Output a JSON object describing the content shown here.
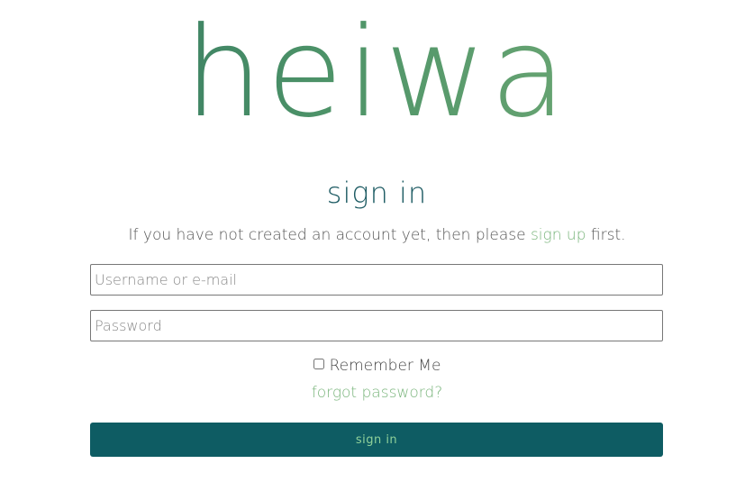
{
  "brand": {
    "logo_text": "heiwa"
  },
  "signin": {
    "title": "sign in",
    "intro_before": "If you have not created an account yet, then please ",
    "signup_link": "sign up",
    "intro_after": " first.",
    "username_placeholder": "Username or e-mail",
    "password_placeholder": "Password",
    "remember_label": "Remember Me",
    "forgot_link": "forgot password?",
    "submit_label": "sign in"
  },
  "colors": {
    "accent_green": "#7ab57c",
    "button_bg": "#0e5c63",
    "title_teal": "#1d5b63"
  }
}
